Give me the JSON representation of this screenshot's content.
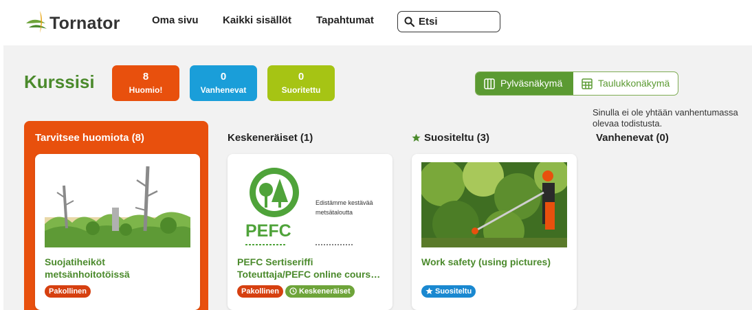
{
  "header": {
    "logo_text": "Tornator",
    "nav": [
      "Oma sivu",
      "Kaikki sisällöt",
      "Tapahtumat"
    ],
    "search_placeholder": "Etsi"
  },
  "main": {
    "title": "Kurssisi",
    "stats": [
      {
        "value": "8",
        "label": "Huomio!",
        "color": "#e8500d"
      },
      {
        "value": "0",
        "label": "Vanhenevat",
        "color": "#1a9ed9"
      },
      {
        "value": "0",
        "label": "Suoritettu",
        "color": "#a6c414"
      }
    ],
    "views": {
      "active": "Pylväsnäkymä",
      "inactive": "Taulukkonäkymä"
    }
  },
  "columns": [
    {
      "title": "Tarvitsee huomiota (8)",
      "card": {
        "title_line1": "Suojatiheiköt",
        "title_line2": "metsänhoitotöissä",
        "badges": [
          "Pakollinen"
        ]
      }
    },
    {
      "title": "Keskeneräiset (1)",
      "card": {
        "image_text_line1": "Edistämme kestävää",
        "image_text_line2": "metsätaloutta",
        "image_logo": "PEFC",
        "title_line1": "PEFC Sertiseriffi",
        "title_line2": "Toteuttaja/PEFC online cours…",
        "badges": [
          "Pakollinen",
          "Keskeneräiset"
        ]
      }
    },
    {
      "title": "Suositeltu (3)",
      "card": {
        "title_line1": "Work safety (using pictures)",
        "badges": [
          "Suositeltu"
        ]
      }
    },
    {
      "title": "Vanhenevat (0)",
      "empty_text_line1": "Sinulla ei ole yhtään vanhentumassa",
      "empty_text_line2": "olevaa todistusta."
    }
  ],
  "colors": {
    "brand_green": "#4b8a2c",
    "orange": "#e8500d",
    "blue": "#1a9ed9",
    "lime": "#a6c414"
  }
}
